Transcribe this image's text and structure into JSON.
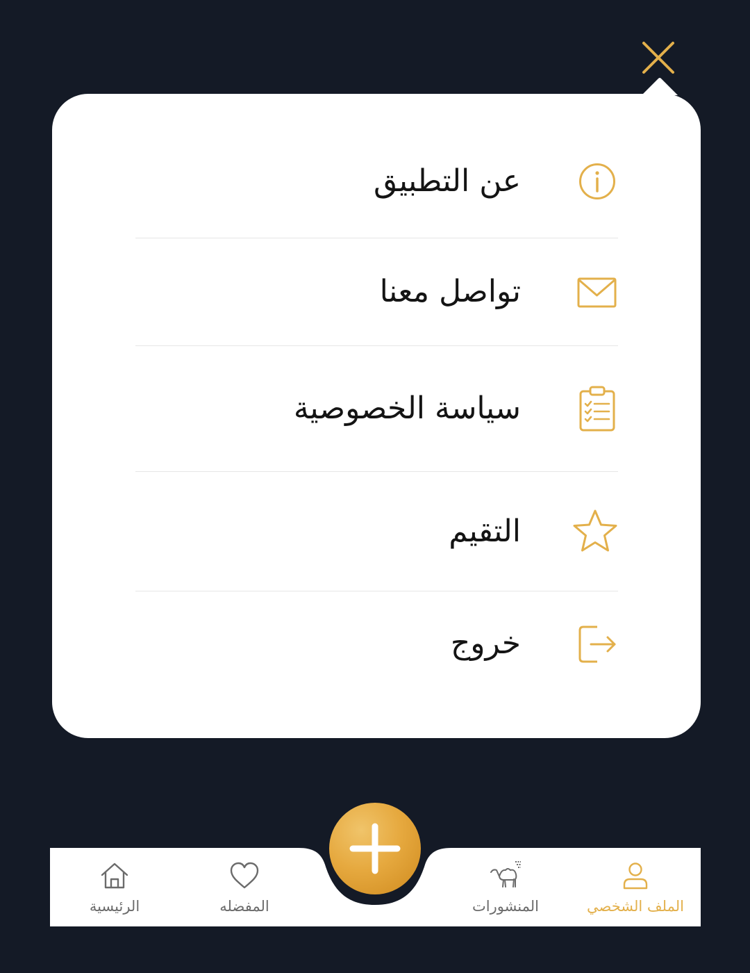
{
  "colors": {
    "background": "#141a26",
    "card": "#ffffff",
    "accent": "#e3b04b",
    "text": "#141414",
    "nav_inactive": "#6b6b6b"
  },
  "close_button": {
    "icon": "close-icon"
  },
  "menu": {
    "items": [
      {
        "label": "عن التطبيق",
        "icon": "info-icon"
      },
      {
        "label": "تواصل معنا",
        "icon": "mail-icon"
      },
      {
        "label": "سياسة الخصوصية",
        "icon": "clipboard-checklist-icon"
      },
      {
        "label": "التقيم",
        "icon": "star-icon"
      },
      {
        "label": "خروج",
        "icon": "logout-icon"
      }
    ]
  },
  "bottom_nav": {
    "items": [
      {
        "label": "الرئيسية",
        "icon": "home-icon",
        "active": false
      },
      {
        "label": "المفضله",
        "icon": "heart-icon",
        "active": false
      },
      {
        "label": "المنشورات",
        "icon": "camel-icon",
        "active": false
      },
      {
        "label": "الملف الشخصي",
        "icon": "user-icon",
        "active": true
      }
    ],
    "fab": {
      "icon": "plus-icon"
    }
  }
}
